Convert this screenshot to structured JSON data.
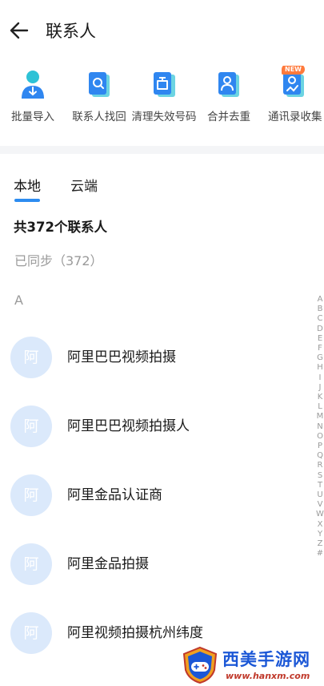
{
  "header": {
    "title": "联系人"
  },
  "tools": [
    {
      "label": "批量导入",
      "icon": "batch-import-icon"
    },
    {
      "label": "联系人找回",
      "icon": "contact-recover-icon"
    },
    {
      "label": "清理失效号码",
      "icon": "clean-invalid-icon"
    },
    {
      "label": "合并去重",
      "icon": "merge-dedupe-icon"
    },
    {
      "label": "通讯录收集",
      "icon": "contacts-collect-icon",
      "badge": "NEW"
    }
  ],
  "tabs": {
    "local": "本地",
    "cloud": "云端"
  },
  "summary": {
    "count": "共372个联系人",
    "synced": "已同步（372）"
  },
  "section_letter": "A",
  "contacts": [
    {
      "avatar": "阿",
      "name": "阿里巴巴视频拍摄"
    },
    {
      "avatar": "阿",
      "name": "阿里巴巴视频拍摄人"
    },
    {
      "avatar": "阿",
      "name": "阿里金品认证商"
    },
    {
      "avatar": "阿",
      "name": "阿里金品拍摄"
    },
    {
      "avatar": "阿",
      "name": "阿里视频拍摄杭州纬度"
    }
  ],
  "alphabet": [
    "A",
    "B",
    "C",
    "D",
    "E",
    "F",
    "G",
    "H",
    "I",
    "J",
    "K",
    "L",
    "M",
    "N",
    "O",
    "P",
    "Q",
    "R",
    "S",
    "T",
    "U",
    "V",
    "W",
    "X",
    "Y",
    "Z",
    "#"
  ],
  "watermark": {
    "title": "西美手游网",
    "url": "www.hanxm.com"
  },
  "colors": {
    "accent": "#2d8cf0",
    "avatar_bg": "#dbe9fb",
    "badge": "#ff7a3c"
  }
}
